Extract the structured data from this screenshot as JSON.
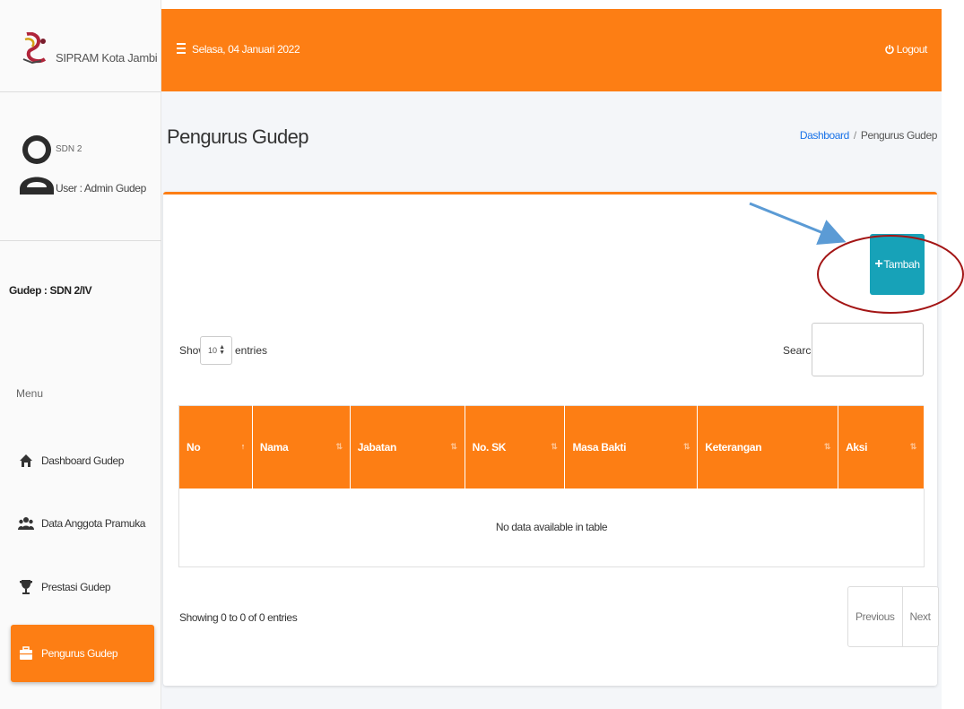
{
  "app": {
    "brand": "SIPRAM Kota Jambi"
  },
  "user": {
    "school": "SDN 2",
    "role": "User : Admin Gudep"
  },
  "gudep": "Gudep : SDN 2/IV",
  "menu": {
    "label": "Menu",
    "items": [
      {
        "label": "Dashboard Gudep",
        "icon": "home-icon",
        "active": false
      },
      {
        "label": "Data Anggota Pramuka",
        "icon": "users-icon",
        "active": false
      },
      {
        "label": "Prestasi Gudep",
        "icon": "trophy-icon",
        "active": false
      },
      {
        "label": "Pengurus Gudep",
        "icon": "briefcase-icon",
        "active": true
      }
    ]
  },
  "topbar": {
    "date": "Selasa, 04 Januari 2022",
    "logout": "Logout"
  },
  "page": {
    "title": "Pengurus Gudep",
    "breadcrumb": {
      "home": "Dashboard",
      "separator": "/",
      "current": "Pengurus Gudep"
    }
  },
  "actions": {
    "add_label": "Tambah"
  },
  "table_controls": {
    "show_label": "Show",
    "page_size": "10",
    "entries_label": "entries",
    "search_label": "Search:"
  },
  "table": {
    "columns": [
      "No",
      "Nama",
      "Jabatan",
      "No. SK",
      "Masa Bakti",
      "Keterangan",
      "Aksi"
    ],
    "empty_message": "No data available in table"
  },
  "footer": {
    "info": "Showing 0 to 0 of 0 entries",
    "previous": "Previous",
    "next": "Next"
  },
  "colors": {
    "primary": "#fd7e14",
    "button": "#17a2b8",
    "link": "#1a73e8",
    "annotation_arrow": "#5b9bd5",
    "annotation_circle": "#a31515"
  }
}
